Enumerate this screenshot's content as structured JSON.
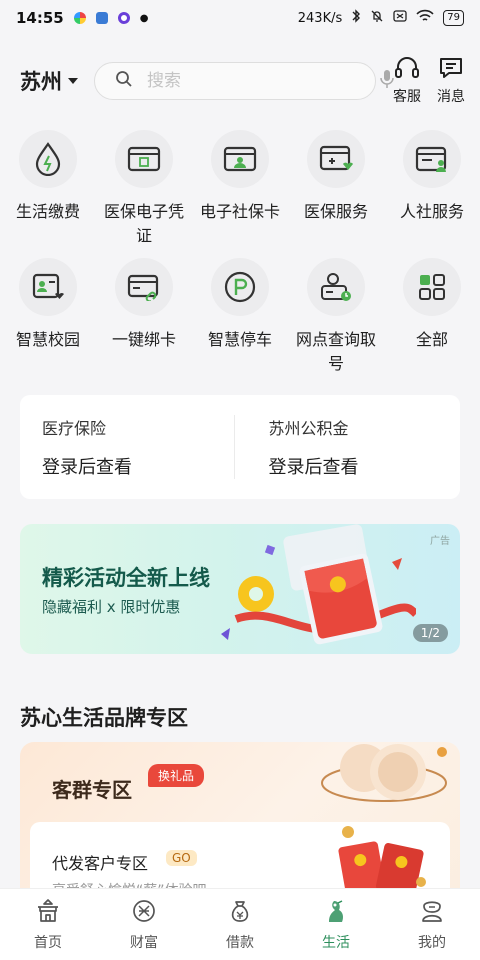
{
  "status_bar": {
    "time": "14:55",
    "network_speed": "243K/s",
    "battery": "79",
    "icons": [
      "bluetooth-icon",
      "mute-icon",
      "sim-off-icon",
      "wifi-icon"
    ]
  },
  "header": {
    "city": "苏州",
    "search_placeholder": "搜索",
    "actions": [
      {
        "label": "客服",
        "icon": "headset-icon"
      },
      {
        "label": "消息",
        "icon": "message-icon"
      }
    ]
  },
  "services": {
    "row1": [
      {
        "label": "生活缴费",
        "icon": "utility-drop-icon"
      },
      {
        "label": "医保电子凭证",
        "icon": "medical-voucher-icon"
      },
      {
        "label": "电子社保卡",
        "icon": "social-card-icon"
      },
      {
        "label": "医保服务",
        "icon": "medical-service-icon"
      },
      {
        "label": "人社服务",
        "icon": "hr-service-icon"
      }
    ],
    "row2": [
      {
        "label": "智慧校园",
        "icon": "campus-icon"
      },
      {
        "label": "一键绑卡",
        "icon": "bind-card-icon"
      },
      {
        "label": "智慧停车",
        "icon": "parking-icon"
      },
      {
        "label": "网点查询取号",
        "icon": "branch-queue-icon"
      },
      {
        "label": "全部",
        "icon": "all-grid-icon"
      }
    ]
  },
  "info": {
    "medical": {
      "title": "医疗保险",
      "value": "登录后查看"
    },
    "fund": {
      "title": "苏州公积金",
      "value": "登录后查看"
    }
  },
  "banner": {
    "title": "精彩活动全新上线",
    "subtitle": "隐藏福利 x 限时优惠",
    "ad": "广告",
    "pager": "1/2"
  },
  "section": {
    "title": "苏心生活品牌专区"
  },
  "brand": {
    "name": "客群专区",
    "tag": "换礼品",
    "sub_title": "代发客户专区",
    "badge": "GO",
    "sub_desc": "享受舒心愉悦“薪”体验吧"
  },
  "tabs": [
    {
      "label": "首页",
      "icon": "home-icon",
      "active": false
    },
    {
      "label": "财富",
      "icon": "wealth-icon",
      "active": false
    },
    {
      "label": "借款",
      "icon": "loan-icon",
      "active": false
    },
    {
      "label": "生活",
      "icon": "life-icon",
      "active": true
    },
    {
      "label": "我的",
      "icon": "profile-icon",
      "active": false
    }
  ],
  "colors": {
    "accent": "#2e8f5c",
    "tag_red": "#e9483b"
  }
}
